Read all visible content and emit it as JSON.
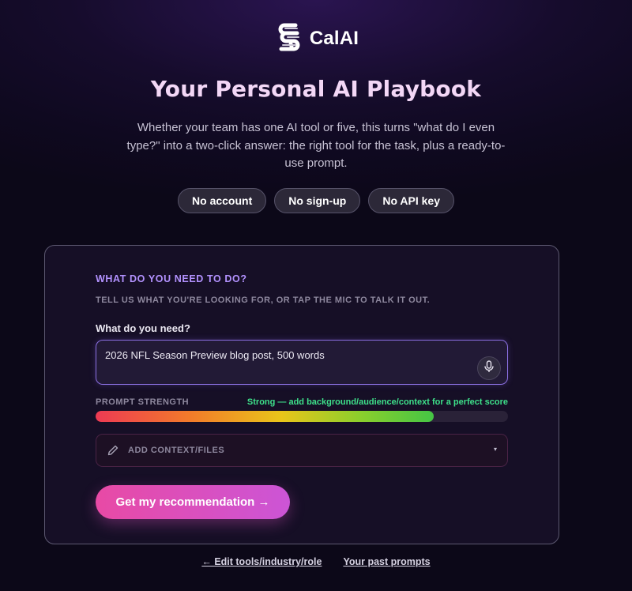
{
  "brand": {
    "name": "CalAI",
    "icon": "stacked-s-logo-icon"
  },
  "hero": {
    "title": "Your Personal AI Playbook",
    "subtitle": "Whether your team has one AI tool or five, this turns \"what do I even type?\" into a two-click answer: the right tool for the task, plus a ready-to-use prompt."
  },
  "pills": [
    "No account",
    "No sign-up",
    "No API key"
  ],
  "form": {
    "kicker": "WHAT DO YOU NEED TO DO?",
    "hint": "TELL US WHAT YOU'RE LOOKING FOR, OR TAP THE MIC TO TALK IT OUT.",
    "field_label": "What do you need?",
    "input_value": "2026 NFL Season Preview blog post, 500 words",
    "mic_icon": "microphone-icon",
    "strength_label": "PROMPT STRENGTH",
    "strength_message": "Strong — add background/audience/context for a perfect score",
    "strength_level": 0.82,
    "context_label": "ADD CONTEXT/FILES",
    "context_icon": "pencil-icon",
    "context_caret": "▾",
    "cta_label": "Get my recommendation →"
  },
  "footer_links": {
    "edit": "← Edit tools/industry/role",
    "past": "Your past prompts"
  },
  "colors": {
    "accent": "#b392ff",
    "success": "#3ee08a",
    "cta_start": "#e84aa5",
    "cta_end": "#cc55d6"
  }
}
